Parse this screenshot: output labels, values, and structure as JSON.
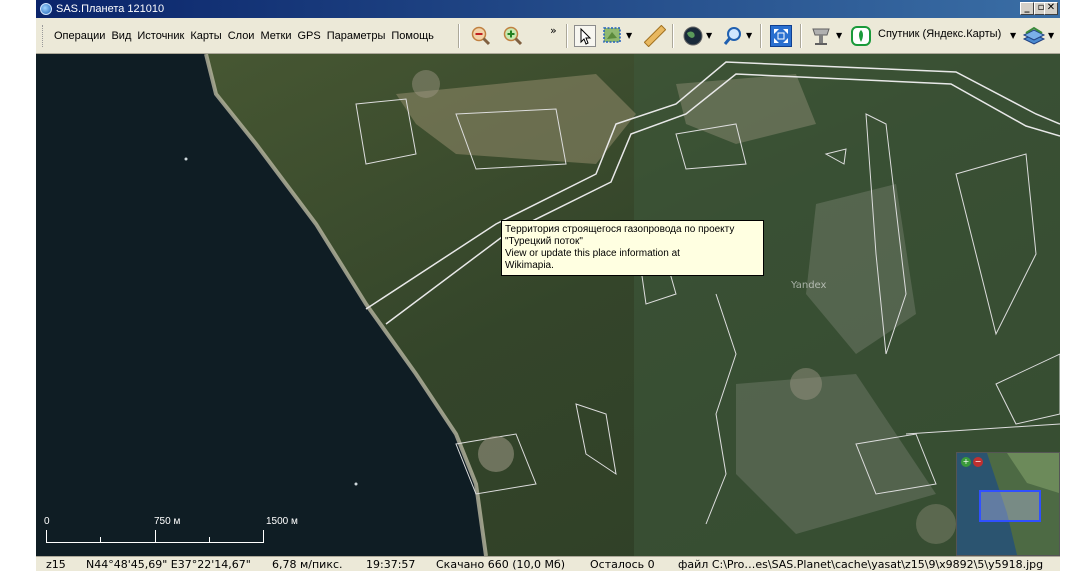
{
  "window": {
    "title": "SAS.Планета 121010",
    "minimize_glyph": "_",
    "maximize_glyph": "▫",
    "close_glyph": "✕"
  },
  "menu": {
    "items": [
      "Операции",
      "Вид",
      "Источник",
      "Карты",
      "Слои",
      "Метки",
      "GPS",
      "Параметры",
      "Помощь"
    ]
  },
  "toolbar": {
    "overflow_glyph": "»",
    "source_label": "Спутник (Яндекс.Карты)",
    "icons": [
      "zoom-out-icon",
      "zoom-in-icon",
      "pointer-icon",
      "selection-icon",
      "ruler-icon",
      "globe-icon",
      "search-icon",
      "fullscreen-icon",
      "gps-satellite-icon",
      "source-icon",
      "layers-icon"
    ]
  },
  "map": {
    "tooltip": {
      "line1": "Территория строящегося газопровода по проекту",
      "line2": "\"Турецкий поток\"",
      "line3": "View or update this place information at",
      "line4": "Wikimapia."
    },
    "watermark": "Yandex",
    "scale": {
      "label_start": "0",
      "label_mid": "750 м",
      "label_end": "1500 м"
    }
  },
  "minimap": {
    "plus": "+",
    "minus": "−"
  },
  "status": {
    "zoom": "z15",
    "coords": "N44°48'45,69\" E37°22'14,67\"",
    "resolution": "6,78 м/пикс.",
    "time": "19:37:57",
    "downloaded": "Скачано 660 (10,0 Мб)",
    "remaining": "Осталось 0",
    "file": "файл C:\\Pro…es\\SAS.Planet\\cache\\yasat\\z15\\9\\x9892\\5\\y5918.jpg"
  },
  "colors": {
    "titlebar_start": "#0a246a",
    "titlebar_end": "#3a6ea5",
    "toolbar_bg": "#ece9d8",
    "tooltip_bg": "#ffffe1",
    "sea": "#0f1d24",
    "land": "#3a4a26"
  }
}
